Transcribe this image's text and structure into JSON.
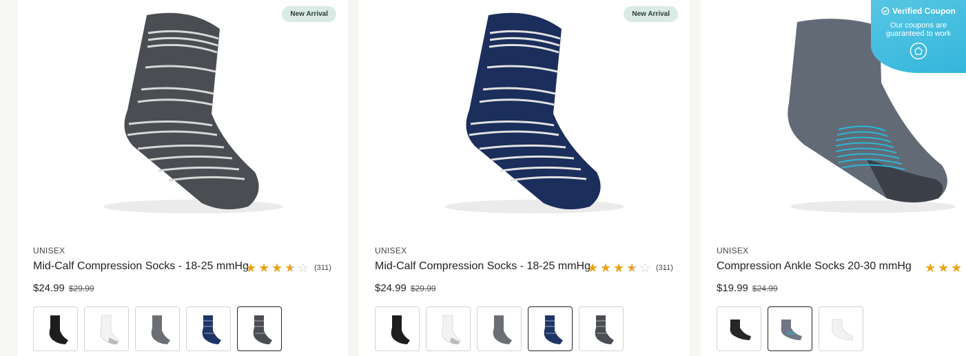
{
  "products": [
    {
      "badge": "New Arrival",
      "gender": "UNISEX",
      "title": "Mid-Calf Compression Socks - 18-25 mmHg",
      "rating_value": 3.5,
      "rating_count": "(311)",
      "price": "$24.99",
      "was_price": "$29.99",
      "main_color": "#4a4d52",
      "stripe_color": "#d8d8d8",
      "swatches": [
        {
          "name": "black",
          "color": "#1d1d1d",
          "heel": "#333"
        },
        {
          "name": "white",
          "color": "#f2f2f2",
          "heel": "#bbb"
        },
        {
          "name": "gray",
          "color": "#6b6e73",
          "heel": "#555"
        },
        {
          "name": "navy-stripe",
          "color": "#1f3566",
          "heel": "#1a2a50"
        },
        {
          "name": "charcoal-stripe",
          "color": "#4a4d52",
          "heel": "#3a3c40",
          "selected": true
        }
      ]
    },
    {
      "badge": "New Arrival",
      "gender": "UNISEX",
      "title": "Mid-Calf Compression Socks - 18-25 mmHg",
      "rating_value": 3.5,
      "rating_count": "(311)",
      "price": "$24.99",
      "was_price": "$29.99",
      "main_color": "#1b2e5c",
      "stripe_color": "#e2e2e2",
      "swatches": [
        {
          "name": "black",
          "color": "#1d1d1d",
          "heel": "#333"
        },
        {
          "name": "white",
          "color": "#f2f2f2",
          "heel": "#bbb"
        },
        {
          "name": "gray",
          "color": "#6b6e73",
          "heel": "#555"
        },
        {
          "name": "navy-stripe",
          "color": "#1f3566",
          "heel": "#1a2a50",
          "selected": true
        },
        {
          "name": "charcoal-stripe",
          "color": "#4a4d52",
          "heel": "#3a3c40"
        }
      ]
    },
    {
      "gender": "UNISEX",
      "title": "Compression Ankle Socks 20-30 mmHg",
      "rating_value": 3,
      "price": "$19.99",
      "was_price": "$24.99",
      "main_color": "#6f7784",
      "stripe_color": "#2bb7d6",
      "swatches": [
        {
          "name": "black",
          "color": "#262626",
          "heel": "#111"
        },
        {
          "name": "heather-gray",
          "color": "#6f7784",
          "heel": "#2bb7d6",
          "selected": true
        },
        {
          "name": "white",
          "color": "#f2f2f2",
          "heel": "#ccc"
        }
      ]
    }
  ],
  "coupon": {
    "title": "Verified Coupon",
    "line1": "Our coupons are",
    "line2": "guaranteed to work",
    "icon": "check-circle-icon",
    "color": "#35b6dc"
  }
}
